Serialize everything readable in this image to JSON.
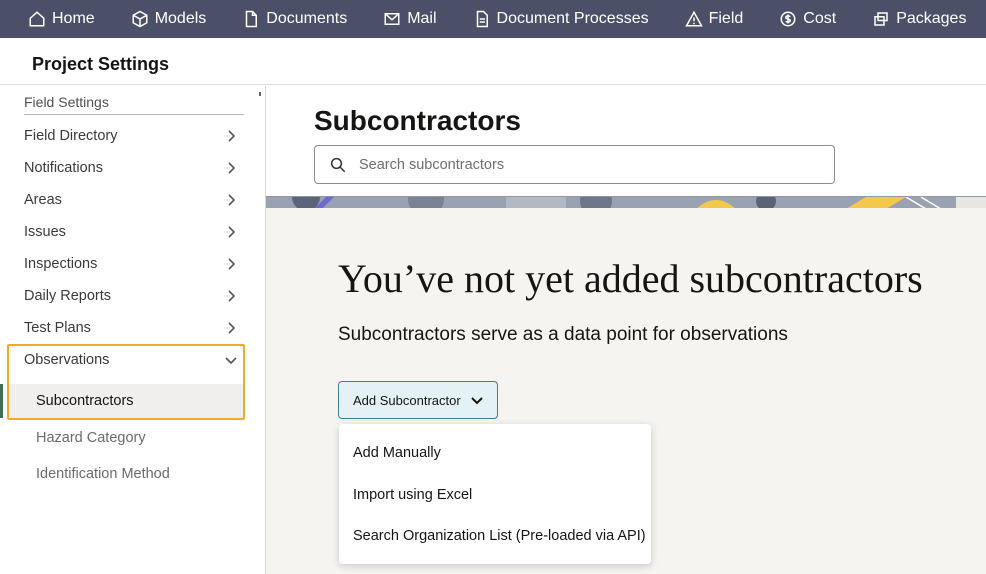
{
  "nav": {
    "items": [
      {
        "label": "Home",
        "icon": "home-icon"
      },
      {
        "label": "Models",
        "icon": "cube-icon"
      },
      {
        "label": "Documents",
        "icon": "document-icon"
      },
      {
        "label": "Mail",
        "icon": "mail-icon"
      },
      {
        "label": "Document Processes",
        "icon": "document-process-icon"
      },
      {
        "label": "Field",
        "icon": "warning-triangle-icon"
      },
      {
        "label": "Cost",
        "icon": "dollar-icon"
      },
      {
        "label": "Packages",
        "icon": "packages-icon"
      }
    ]
  },
  "header": {
    "title": "Project Settings"
  },
  "sidebar": {
    "heading": "Field Settings",
    "items": [
      {
        "label": "Field Directory"
      },
      {
        "label": "Notifications"
      },
      {
        "label": "Areas"
      },
      {
        "label": "Issues"
      },
      {
        "label": "Inspections"
      },
      {
        "label": "Daily Reports"
      },
      {
        "label": "Test Plans"
      },
      {
        "label": "Observations"
      }
    ],
    "sub_items": [
      {
        "label": "Subcontractors",
        "selected": true
      },
      {
        "label": "Hazard Category"
      },
      {
        "label": "Identification Method"
      }
    ]
  },
  "main": {
    "title": "Subcontractors",
    "search_placeholder": "Search subcontractors",
    "empty_title": "You’ve not yet added subcontractors",
    "empty_subtitle": "Subcontractors serve as a data point for observations",
    "add_button": "Add Subcontractor",
    "menu": [
      "Add Manually",
      "Import using Excel",
      "Search Organization List (Pre-loaded via API)"
    ]
  },
  "colors": {
    "nav_bg": "#4b5068",
    "highlight": "#f0a92e",
    "button_bg": "#e4f1f5",
    "button_border": "#3d7f92",
    "content_bg": "#f6f4f1"
  }
}
